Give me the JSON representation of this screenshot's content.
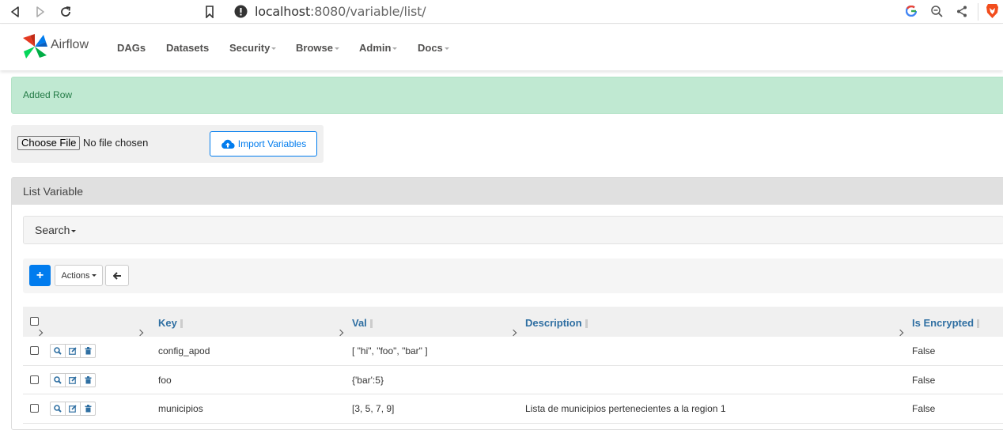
{
  "browser": {
    "url_host": "localhost",
    "url_rest": ":8080/variable/list/"
  },
  "navbar": {
    "brand": "Airflow",
    "items": [
      {
        "label": "DAGs",
        "dropdown": false
      },
      {
        "label": "Datasets",
        "dropdown": false
      },
      {
        "label": "Security",
        "dropdown": true
      },
      {
        "label": "Browse",
        "dropdown": true
      },
      {
        "label": "Admin",
        "dropdown": true
      },
      {
        "label": "Docs",
        "dropdown": true
      }
    ]
  },
  "alert": {
    "message": "Added Row"
  },
  "import": {
    "choose_file_label": "Choose File",
    "file_status": "No file chosen",
    "import_button": "Import Variables"
  },
  "panel": {
    "title": "List Variable",
    "search_label": "Search",
    "actions_label": "Actions"
  },
  "table": {
    "columns": {
      "key": "Key",
      "val": "Val",
      "description": "Description",
      "is_encrypted": "Is Encrypted"
    },
    "rows": [
      {
        "key": "config_apod",
        "val": "[ \"hi\", \"foo\", \"bar\" ]",
        "description": "",
        "is_encrypted": "False"
      },
      {
        "key": "foo",
        "val": "{'bar':5}",
        "description": "",
        "is_encrypted": "False"
      },
      {
        "key": "municipios",
        "val": "[3, 5, 7, 9]",
        "description": "Lista de municipios pertenecientes a la region 1",
        "is_encrypted": "False"
      }
    ]
  },
  "colors": {
    "accent": "#017cee",
    "alert_bg": "#c0e9d2",
    "alert_text": "#227a45",
    "header_link": "#2f6fa2"
  },
  "icons": [
    "back-arrow-icon",
    "forward-arrow-icon",
    "reload-icon",
    "bookmark-icon",
    "info-icon",
    "google-icon",
    "zoom-icon",
    "share-icon",
    "brave-icon",
    "cloud-upload-icon",
    "plus-icon",
    "arrow-left-icon",
    "search-icon",
    "edit-icon",
    "trash-icon"
  ]
}
